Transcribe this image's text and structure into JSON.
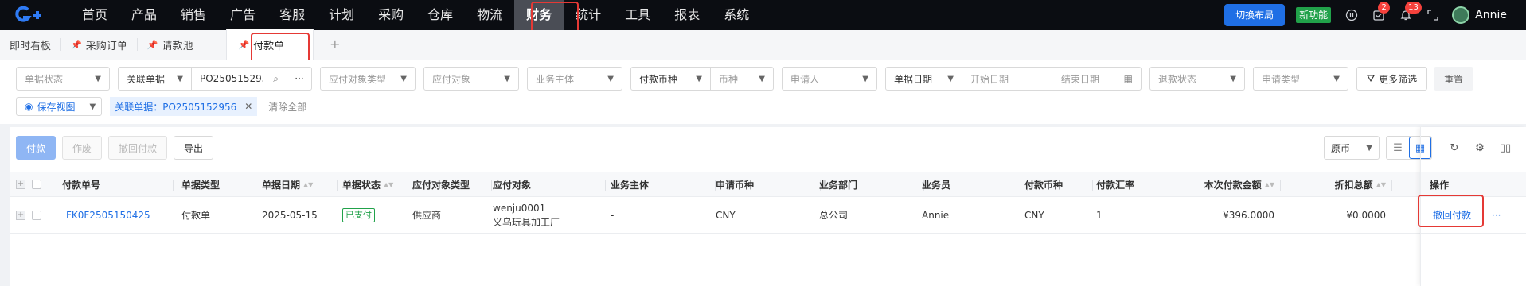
{
  "nav": {
    "menu": [
      "首页",
      "产品",
      "销售",
      "广告",
      "客服",
      "计划",
      "采购",
      "仓库",
      "物流",
      "财务",
      "统计",
      "工具",
      "报表",
      "系统"
    ],
    "active_index": 9,
    "switch_layout": "切换布局",
    "new_feature": "新功能",
    "task_badge": "2",
    "notify_badge": "13",
    "user_name": "Annie"
  },
  "tabs": {
    "items": [
      "即时看板",
      "采购订单",
      "请款池",
      "付款单"
    ],
    "active": "付款单",
    "add": "+"
  },
  "filters": {
    "doc_status": "单据状态",
    "linked_doc_label": "关联单据",
    "linked_doc_value": "PO2505152956",
    "payee_type": "应付对象类型",
    "payee": "应付对象",
    "business_entity": "业务主体",
    "pay_currency_label": "付款币种",
    "currency": "币种",
    "applicant": "申请人",
    "doc_date_label": "单据日期",
    "start_date": "开始日期",
    "date_sep": "-",
    "end_date": "结束日期",
    "refund_status": "退款状态",
    "request_type": "申请类型",
    "more_filters": "更多筛选",
    "reset": "重置",
    "save_view": "保存视图",
    "chip": "关联单据：PO2505152956",
    "clear_all": "清除全部"
  },
  "actions": {
    "pay": "付款",
    "void": "作废",
    "revoke": "撤回付款",
    "export": "导出",
    "currency_mode": "原币"
  },
  "table": {
    "headers": [
      "付款单号",
      "单据类型",
      "单据日期",
      "单据状态",
      "应付对象类型",
      "应付对象",
      "业务主体",
      "申请币种",
      "业务部门",
      "业务员",
      "付款币种",
      "付款汇率",
      "本次付款金额",
      "折扣总额",
      "操作"
    ],
    "rows": [
      {
        "no": "FK0F2505150425",
        "type": "付款单",
        "date": "2025-05-15",
        "status": "已支付",
        "payee_type": "供应商",
        "payee_line1": "wenju0001",
        "payee_line2": "义乌玩具加工厂",
        "entity": "-",
        "req_currency": "CNY",
        "department": "总公司",
        "salesperson": "Annie",
        "pay_currency": "CNY",
        "rate": "1",
        "amount": "¥396.0000",
        "discount": "¥0.0000",
        "op": "撤回付款",
        "more": "···"
      }
    ]
  },
  "colors": {
    "nav_bg": "#0b0d12",
    "accent": "#1f6fe5",
    "success": "#21a24a",
    "highlight": "#e53935"
  }
}
